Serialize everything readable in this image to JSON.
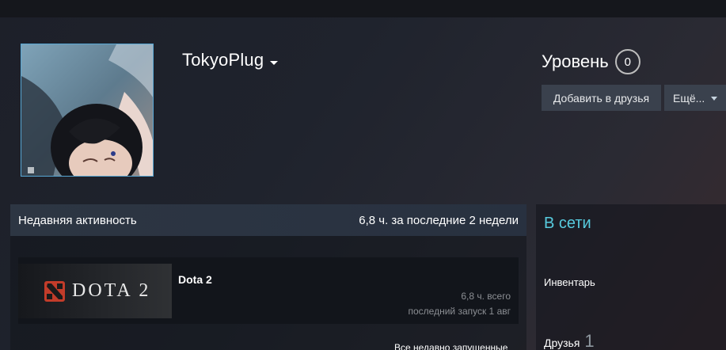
{
  "profile": {
    "persona_name": "TokyoPlug",
    "level_label": "Уровень",
    "level_value": "0",
    "add_friend_label": "Добавить в друзья",
    "more_label": "Ещё..."
  },
  "recent_activity": {
    "title": "Недавняя активность",
    "summary": "6,8 ч. за последние 2 недели",
    "games": [
      {
        "name": "Dota 2",
        "capsule_text": "DOTA 2",
        "hours_total": "6,8 ч. всего",
        "last_played": "последний запуск 1 авг"
      }
    ],
    "all_recent_label": "Все недавно запущенные"
  },
  "sidebar": {
    "status": "В сети",
    "inventory_label": "Инвентарь",
    "friends_label": "Друзья",
    "friends_count": "1"
  },
  "colors": {
    "status_online": "#57cbde",
    "button_bg": "#3a414d",
    "avatar_border": "#57a7d4"
  },
  "icons": [
    "dropdown-caret-icon",
    "dota-logo-icon"
  ]
}
